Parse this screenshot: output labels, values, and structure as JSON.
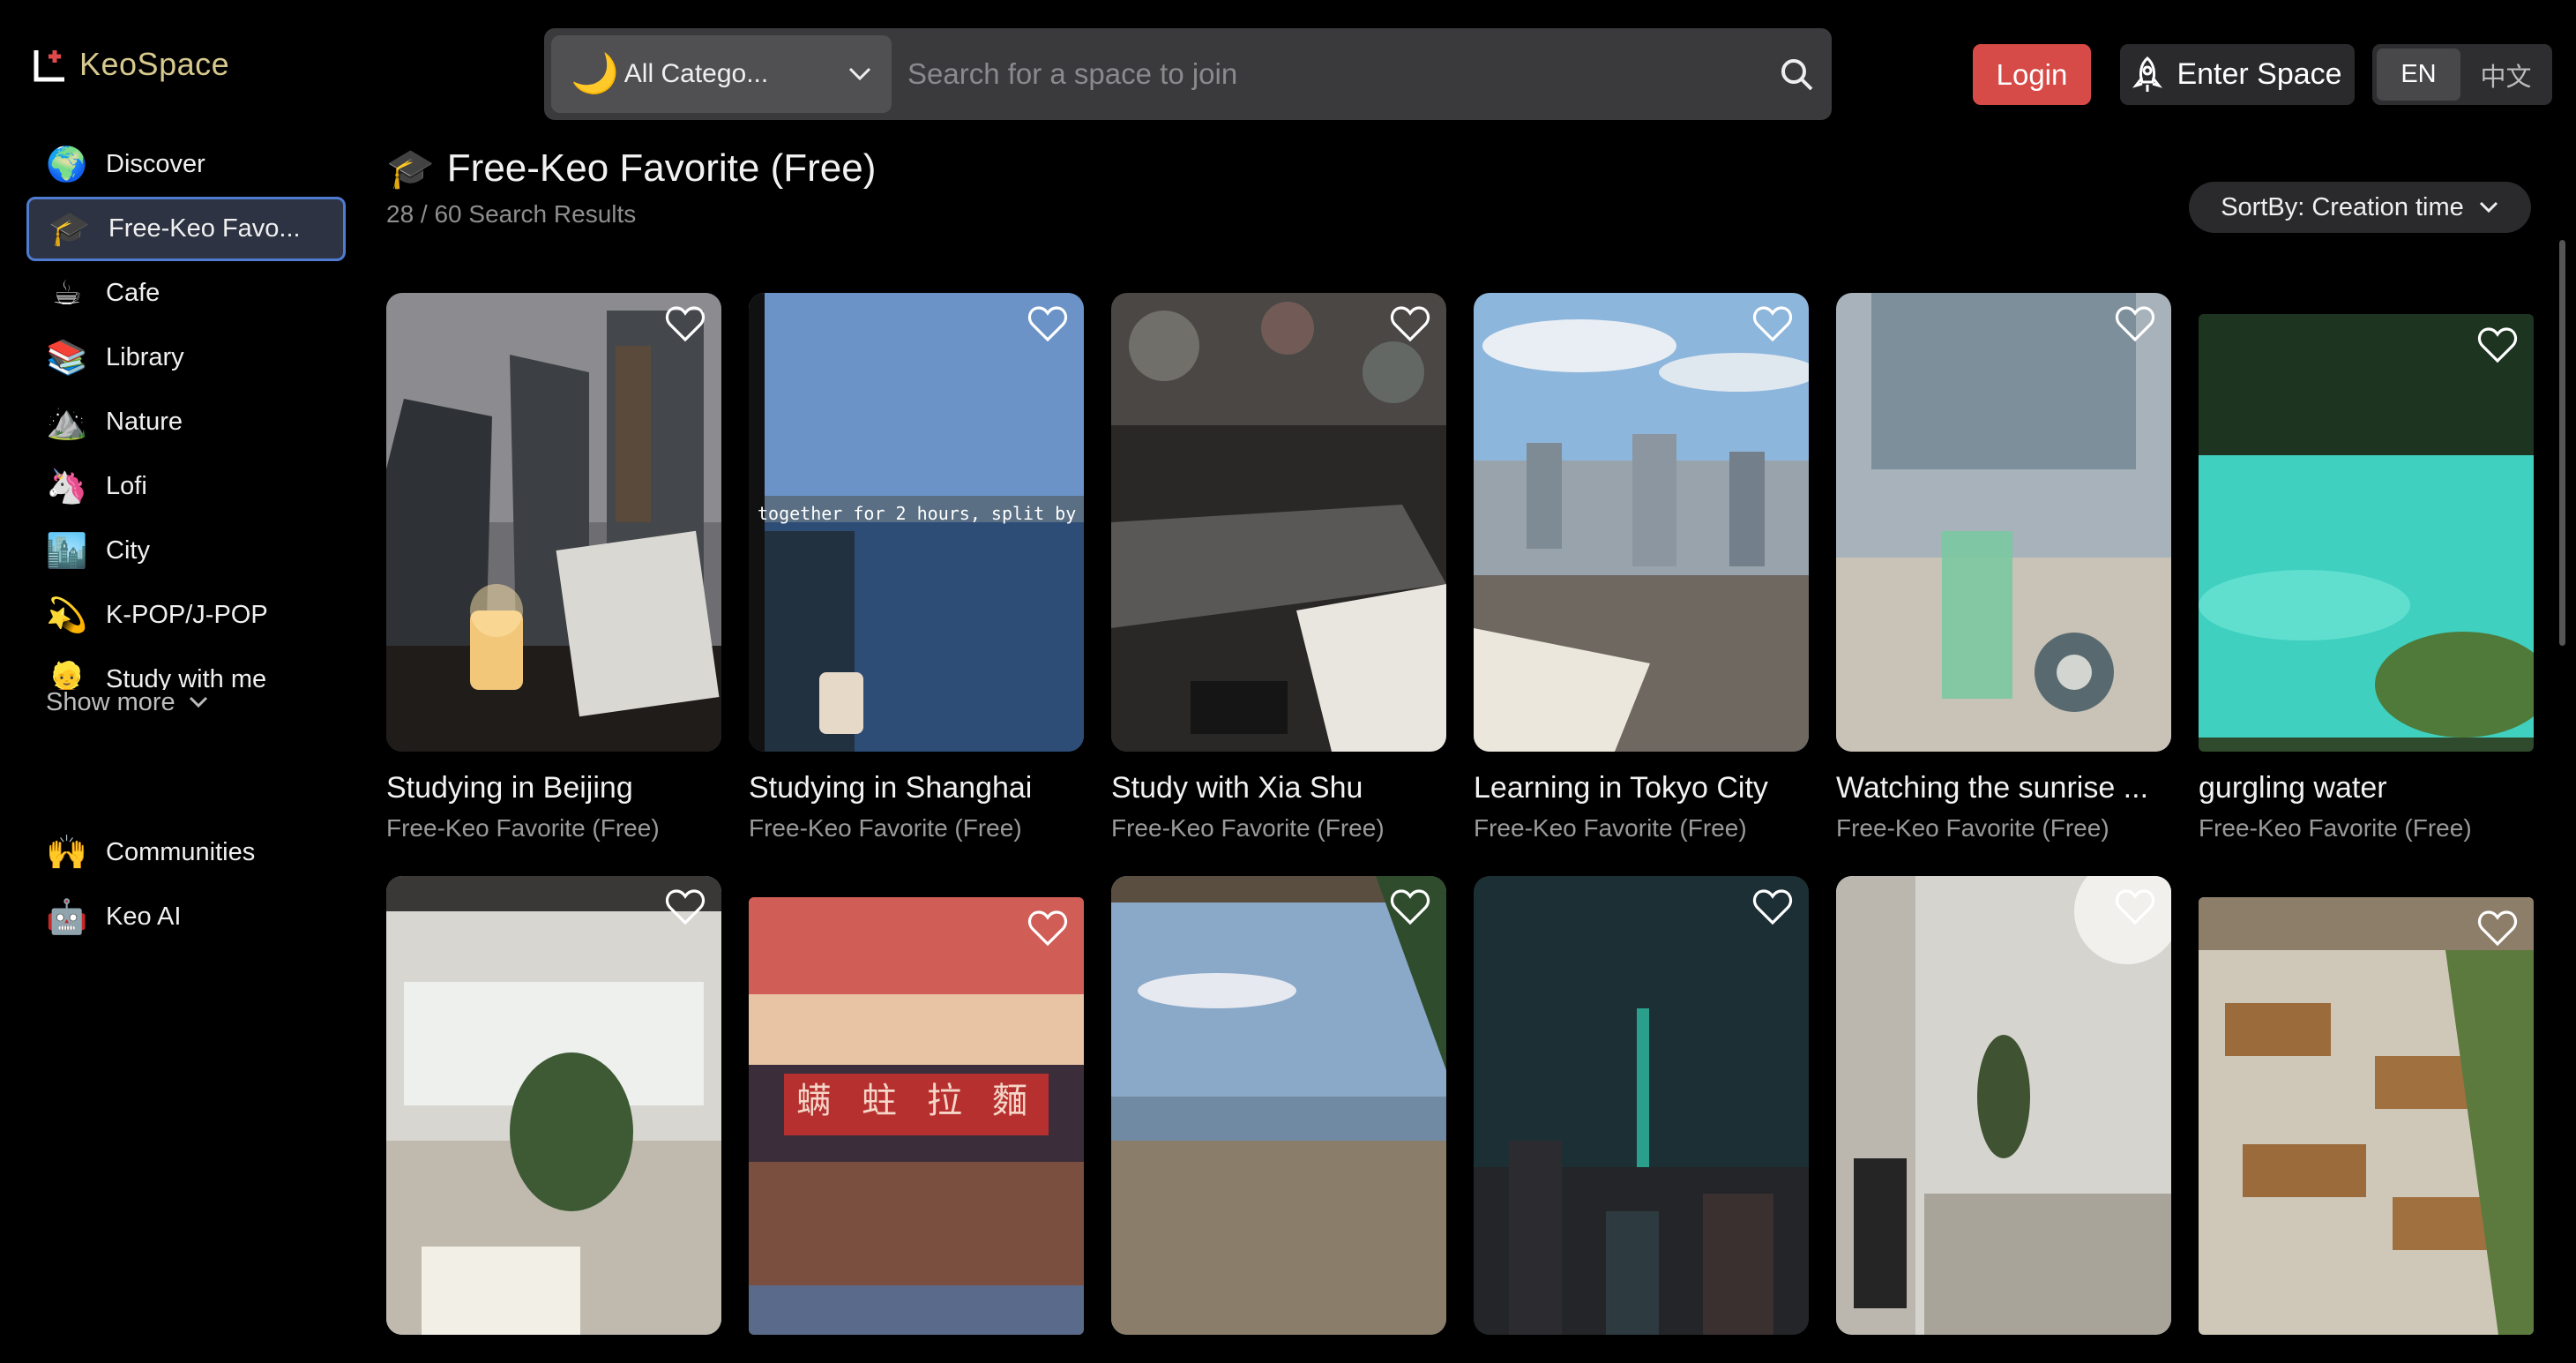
{
  "app": {
    "name": "KeoSpace"
  },
  "search": {
    "category": "All Catego...",
    "placeholder": "Search for a space to join"
  },
  "header": {
    "login": "Login",
    "enter_space": "Enter Space",
    "lang_en": "EN",
    "lang_zh": "中文"
  },
  "sidebar": {
    "items": [
      {
        "label": "Discover",
        "icon": "🌍",
        "name": "sidebar-item-discover"
      },
      {
        "label": "Free-Keo Favo...",
        "icon": "🎓",
        "name": "sidebar-item-free-keo-favorite"
      },
      {
        "label": "Cafe",
        "icon": "☕",
        "name": "sidebar-item-cafe"
      },
      {
        "label": "Library",
        "icon": "📚",
        "name": "sidebar-item-library"
      },
      {
        "label": "Nature",
        "icon": "⛰️",
        "name": "sidebar-item-nature"
      },
      {
        "label": "Lofi",
        "icon": "🦄",
        "name": "sidebar-item-lofi"
      },
      {
        "label": "City",
        "icon": "🏙️",
        "name": "sidebar-item-city"
      },
      {
        "label": "K-POP/J-POP",
        "icon": "💫",
        "name": "sidebar-item-kpop-jpop"
      },
      {
        "label": "Study with me",
        "icon": "👱",
        "name": "sidebar-item-study-with-me"
      }
    ],
    "show_more": "Show more",
    "bottom": [
      {
        "label": "Communities",
        "icon": "🙌",
        "name": "sidebar-item-communities"
      },
      {
        "label": "Keo AI",
        "icon": "🤖",
        "name": "sidebar-item-keo-ai"
      }
    ]
  },
  "main": {
    "title": "Free-Keo Favorite (Free)",
    "count": "28 / 60 Search Results",
    "sort_label": "SortBy: Creation time"
  },
  "cards": [
    {
      "title": "Studying in Beijing",
      "subtitle": "Free-Keo Favorite (Free)",
      "scene": "beijing"
    },
    {
      "title": "Studying in Shanghai",
      "subtitle": "Free-Keo Favorite (Free)",
      "scene": "shanghai",
      "overlay": "together for 2 hours, split by"
    },
    {
      "title": "Study with Xia Shu",
      "subtitle": "Free-Keo Favorite (Free)",
      "scene": "keyboard"
    },
    {
      "title": "Learning in Tokyo City",
      "subtitle": "Free-Keo Favorite (Free)",
      "scene": "tokyo"
    },
    {
      "title": "Watching the sunrise ...",
      "subtitle": "Free-Keo Favorite (Free)",
      "scene": "sunrise"
    },
    {
      "title": "gurgling water",
      "subtitle": "Free-Keo Favorite (Free)",
      "scene": "water"
    },
    {
      "scene": "cafe"
    },
    {
      "scene": "noodle",
      "sign": [
        "螨",
        "蛀",
        "拉",
        "麵"
      ]
    },
    {
      "scene": "terrace"
    },
    {
      "scene": "night"
    },
    {
      "scene": "interior"
    },
    {
      "scene": "library"
    }
  ]
}
